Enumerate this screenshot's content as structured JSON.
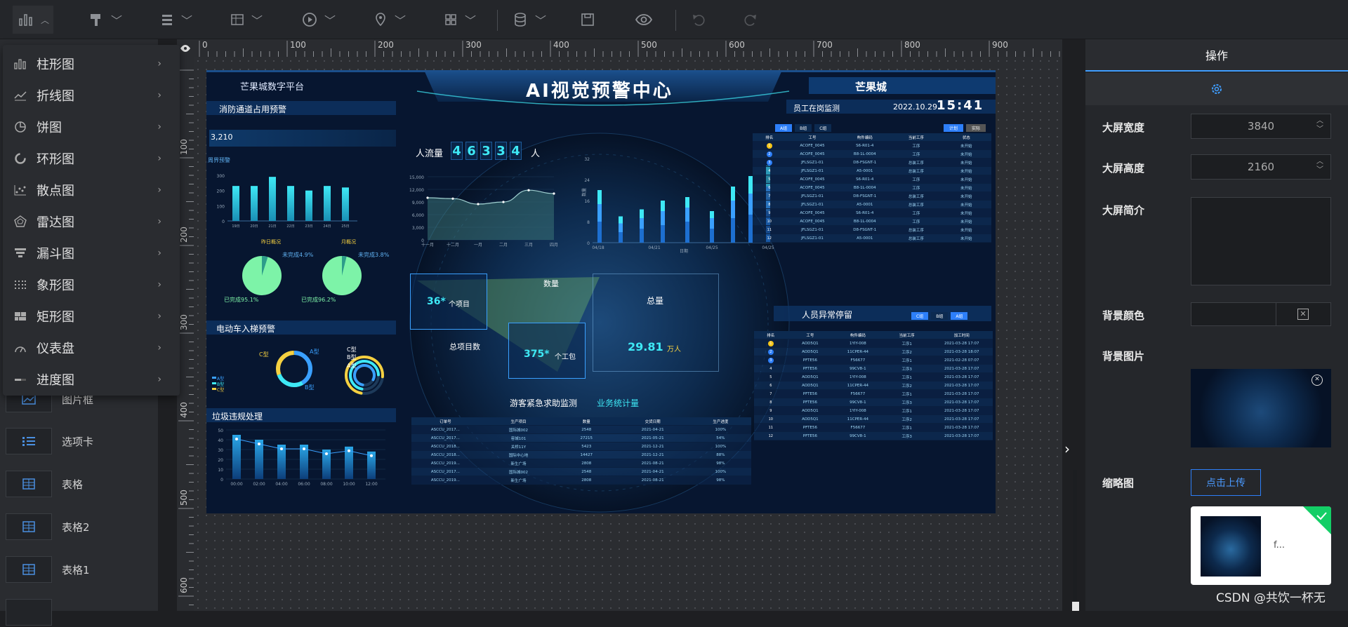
{
  "toolbar": {
    "icons": [
      "bar-chart-icon",
      "paint-brush-icon",
      "list-icon",
      "table-icon",
      "play-icon",
      "location-pin-icon",
      "grid-apps-icon",
      "database-icon",
      "save-icon",
      "eye-icon",
      "undo-icon",
      "redo-icon"
    ]
  },
  "dropdown": {
    "items": [
      {
        "label": "柱形图",
        "icon": "bar-chart-icon"
      },
      {
        "label": "折线图",
        "icon": "line-chart-icon"
      },
      {
        "label": "饼图",
        "icon": "pie-chart-icon"
      },
      {
        "label": "环形图",
        "icon": "ring-chart-icon"
      },
      {
        "label": "散点图",
        "icon": "scatter-chart-icon"
      },
      {
        "label": "雷达图",
        "icon": "radar-chart-icon"
      },
      {
        "label": "漏斗图",
        "icon": "funnel-chart-icon"
      },
      {
        "label": "象形图",
        "icon": "pictorial-chart-icon"
      },
      {
        "label": "矩形图",
        "icon": "treemap-chart-icon"
      },
      {
        "label": "仪表盘",
        "icon": "gauge-chart-icon"
      },
      {
        "label": "进度图",
        "icon": "progress-chart-icon"
      }
    ]
  },
  "left_panel": {
    "items": [
      {
        "label": "图片框",
        "icon": "image-frame-icon"
      },
      {
        "label": "选项卡",
        "icon": "tabs-icon"
      },
      {
        "label": "表格",
        "icon": "table-icon"
      },
      {
        "label": "表格2",
        "icon": "table-icon"
      },
      {
        "label": "表格1",
        "icon": "table-icon"
      }
    ]
  },
  "ruler": {
    "top": [
      "0",
      "100",
      "200",
      "300",
      "400",
      "500",
      "600",
      "700",
      "800",
      "900"
    ],
    "left": [
      "100",
      "200",
      "300",
      "400",
      "500",
      "600"
    ]
  },
  "screen": {
    "platform_title": "芒果城数字平台",
    "main_title": "AI视觉预警中心",
    "right_header": "芒果城",
    "fire_title": "消防通道占用预警",
    "fire_value": "3,210",
    "fire_chart_label": "周界预警",
    "fire_bars": {
      "labels": [
        "19日",
        "20日",
        "21日",
        "22日",
        "23日",
        "24日",
        "25日"
      ],
      "values": [
        230,
        230,
        290,
        230,
        200,
        230,
        220
      ],
      "yticks": [
        "300",
        "200",
        "100",
        "0"
      ]
    },
    "pie_labels": {
      "daily": "昨日概况",
      "monthly": "月概况",
      "unfinished1": "未完成4.9%",
      "done1": "已完成95.1%",
      "unfinished2": "未完成3.8%",
      "done2": "已完成96.2%"
    },
    "pies": [
      {
        "unfinished": 4.9,
        "done": 95.1
      },
      {
        "unfinished": 3.8,
        "done": 96.2
      }
    ],
    "ebike_title": "电动车入梯预警",
    "ebike_legend": [
      "A型",
      "B型",
      "C型"
    ],
    "ebike_labels": {
      "c": "C型",
      "a": "A型",
      "b": "B型",
      "c2": "C型",
      "b2": "B型",
      "a2": "A型"
    },
    "garbage_title": "垃圾违规处理",
    "garbage_yticks": [
      "50",
      "40",
      "30",
      "20",
      "10",
      "0"
    ],
    "garbage_xticks": [
      "00:00",
      "02:00",
      "04:00",
      "06:00",
      "08:00",
      "10:00",
      "12:00"
    ],
    "garbage_values": [
      45,
      40,
      35,
      35,
      30,
      33,
      28
    ],
    "flow": {
      "label": "人流量",
      "digits": [
        "4",
        "6",
        "3",
        "3",
        "4"
      ],
      "unit": "人",
      "xticks": [
        "十一月",
        "十二月",
        "一月",
        "二月",
        "三月",
        "四月"
      ],
      "yticks": [
        "15,000",
        "12,000",
        "9,000",
        "6,000",
        "3,000",
        "0"
      ],
      "values": [
        10000,
        9800,
        8500,
        9000,
        11800,
        11000
      ]
    },
    "stacked": {
      "yticks": [
        "32",
        "24",
        "16",
        "8",
        "0"
      ],
      "xticks": [
        "04/18",
        "04/21",
        "04/25",
        "04/25"
      ],
      "ylabel": "数量",
      "xlabel": "日期"
    },
    "stats": {
      "projects_num": "36*",
      "projects_unit": "个项目",
      "count_label": "数量",
      "total_label": "总量",
      "total_value": "29.81",
      "total_unit": "万人",
      "total_projects": "总项目数",
      "workers_num": "375*",
      "workers_unit": "个工包"
    },
    "rescue": {
      "title": "游客紧急求助监测",
      "subtitle": "业务统计量",
      "headers": [
        "订单号",
        "生产项目",
        "数量",
        "交货日期",
        "生产进度"
      ],
      "rows": [
        [
          "ASCCU_2017...",
          "国际城002",
          "2548",
          "2021-04-21",
          "100%"
        ],
        [
          "ASCCU_2017...",
          "容城101",
          "27215",
          "2021-05-21",
          "54%"
        ],
        [
          "ASCCU_2018...",
          "关桥11Y",
          "5423",
          "2021-12-21",
          "100%"
        ],
        [
          "ASCCU_2018...",
          "国际中心地",
          "14427",
          "2021-12-21",
          "88%"
        ],
        [
          "ASCCU_2019...",
          "新生广场",
          "2808",
          "2021-08-21",
          "98%"
        ],
        [
          "ASCCU_2017...",
          "国际城002",
          "2548",
          "2021-04-21",
          "100%"
        ],
        [
          "ASCCU_2019...",
          "新生广场",
          "2808",
          "2021-08-21",
          "98%"
        ]
      ]
    },
    "staff": {
      "title": "员工在岗监测",
      "date": "2022.10.29",
      "time": "15:41",
      "tabs": [
        "A组",
        "B组",
        "C组"
      ],
      "btns": [
        "计划",
        "实际"
      ],
      "headers": [
        "排名",
        "工号",
        "构件编码",
        "当前工序",
        "状态"
      ],
      "rows": [
        [
          "1",
          "ACOFE_0045",
          "S6-R01-4",
          "工序",
          "未开始"
        ],
        [
          "2",
          "ACOFE_0045",
          "B8-1L-0004",
          "工序",
          "未开始"
        ],
        [
          "3",
          "JFLSGZ1-01",
          "D8-FSGNT-1",
          "总装工序",
          "未开始"
        ],
        [
          "4",
          "JFLSGZ1-01",
          "A5-0001",
          "总装工序",
          "未开始"
        ],
        [
          "5",
          "ACOFE_0045",
          "S6-R01-4",
          "工序",
          "未开始"
        ],
        [
          "6",
          "ACOFE_0045",
          "B8-1L-0004",
          "工序",
          "未开始"
        ],
        [
          "7",
          "JFLSGZ1-01",
          "D8-FSGNT-1",
          "总装工序",
          "未开始"
        ],
        [
          "8",
          "JFLSGZ1-01",
          "A5-0001",
          "总装工序",
          "未开始"
        ],
        [
          "9",
          "ACOFE_0045",
          "S6-R01-4",
          "工序",
          "未开始"
        ],
        [
          "10",
          "ACOFE_0045",
          "B8-1L-0004",
          "工序",
          "未开始"
        ],
        [
          "11",
          "JFLSGZ1-01",
          "D8-FSGNT-1",
          "总装工序",
          "未开始"
        ],
        [
          "12",
          "JFLSGZ1-01",
          "A5-0001",
          "总装工序",
          "未开始"
        ]
      ]
    },
    "abnormal": {
      "title": "人员异常停留",
      "tabs": [
        "C组",
        "B组",
        "A组"
      ],
      "headers": [
        "排名",
        "工号",
        "构件编码",
        "当前工序",
        "加工时间"
      ],
      "rows": [
        [
          "1",
          "AOD5Q1",
          "1YIY-008",
          "工序1",
          "2021-03-28 17:07"
        ],
        [
          "2",
          "AOD5Q1",
          "11CPER-44",
          "工序2",
          "2021-03-28 18:07"
        ],
        [
          "3",
          "PFTE56",
          "F56677",
          "工序1",
          "2021-02-28 07:07"
        ],
        [
          "4",
          "PFTE56",
          "99CV8-1",
          "工序3",
          "2021-03-28 17:07"
        ],
        [
          "5",
          "AOD5Q1",
          "1YIY-008",
          "工序1",
          "2021-03-28 17:07"
        ],
        [
          "6",
          "AOD5Q1",
          "11CPER-44",
          "工序2",
          "2021-03-28 17:07"
        ],
        [
          "7",
          "PFTE56",
          "F56677",
          "工序1",
          "2021-03-28 17:07"
        ],
        [
          "8",
          "PFTE56",
          "99CV8-1",
          "工序3",
          "2021-03-28 17:07"
        ],
        [
          "9",
          "AOD5Q1",
          "1YIY-008",
          "工序1",
          "2021-03-28 17:07"
        ],
        [
          "10",
          "AOD5Q1",
          "11CPER-44",
          "工序2",
          "2021-03-28 17:07"
        ],
        [
          "11",
          "PFTE56",
          "F56677",
          "工序1",
          "2021-03-28 17:07"
        ],
        [
          "12",
          "PFTE56",
          "99CV8-1",
          "工序3",
          "2021-03-28 17:07"
        ]
      ]
    }
  },
  "right_panel": {
    "title": "操作",
    "width_label": "大屏宽度",
    "width_value": "3840",
    "height_label": "大屏高度",
    "height_value": "2160",
    "desc_label": "大屏简介",
    "bg_color_label": "背景颜色",
    "bg_image_label": "背景图片",
    "thumb_label": "缩略图",
    "upload_label": "点击上传",
    "file_name": "f..."
  },
  "watermark": "CSDN @共饮一杯无",
  "colors": {
    "accent": "#409eff",
    "cyan": "#3ee8f5",
    "green": "#7df3a8",
    "upload_border": "#2d7ff9"
  }
}
